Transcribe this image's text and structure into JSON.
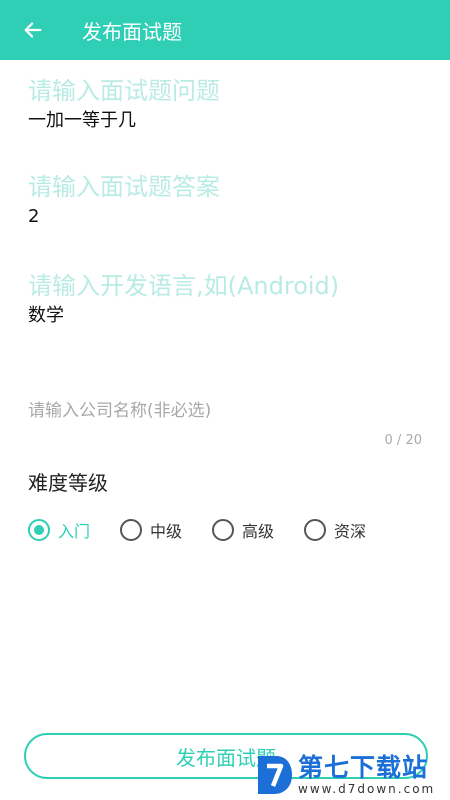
{
  "header": {
    "title": "发布面试题"
  },
  "question": {
    "label": "请输入面试题问题",
    "value": "一加一等于几"
  },
  "answer": {
    "label": "请输入面试题答案",
    "value": "2"
  },
  "language": {
    "label": "请输入开发语言,如(Android)",
    "value": "数学"
  },
  "company": {
    "placeholder": "请输入公司名称(非必选)",
    "value": "",
    "counter": "0 / 20"
  },
  "difficulty": {
    "label": "难度等级",
    "options": [
      "入门",
      "中级",
      "高级",
      "资深"
    ],
    "selected": "入门"
  },
  "submit": {
    "label": "发布面试题"
  },
  "watermark": {
    "name": "第七下载站",
    "url": "www.d7down.com"
  },
  "colors": {
    "accent": "#2fcfb5",
    "watermark": "#1b6fd6"
  }
}
